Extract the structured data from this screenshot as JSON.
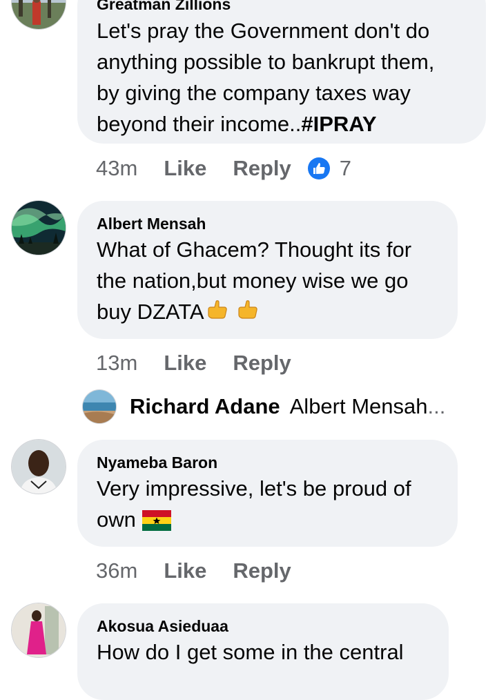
{
  "comments": [
    {
      "author": "Greatman Zillions",
      "text": "Let's pray the Government don't do\nanything possible to bankrupt them,\nby giving the company taxes way\nbeyond their income..",
      "hashtag": "#IPRAY",
      "time": "43m",
      "like_label": "Like",
      "reply_label": "Reply",
      "reaction_count": "7"
    },
    {
      "author": "Albert Mensah",
      "text": "What of Ghacem? Thought its for\nthe nation,but money wise we go\nbuy DZATA",
      "time": "13m",
      "like_label": "Like",
      "reply_label": "Reply",
      "reply": {
        "author": "Richard Adane",
        "text": "Albert Mensah",
        "ellipsis": "..."
      }
    },
    {
      "author": "Nyameba Baron",
      "text": "Very impressive, let's be proud of\nown",
      "time": "36m",
      "like_label": "Like",
      "reply_label": "Reply"
    },
    {
      "author": "Akosua Asieduaa",
      "text": "How do I get some in the central"
    }
  ],
  "icons": {
    "reaction": "like-reaction-icon",
    "thumbs": "thumbs-up-emoji",
    "flag": "ghana-flag-emoji"
  },
  "colors": {
    "bubble": "#f0f2f5",
    "meta_text": "#65676b",
    "like_blue": "#1877f2"
  }
}
